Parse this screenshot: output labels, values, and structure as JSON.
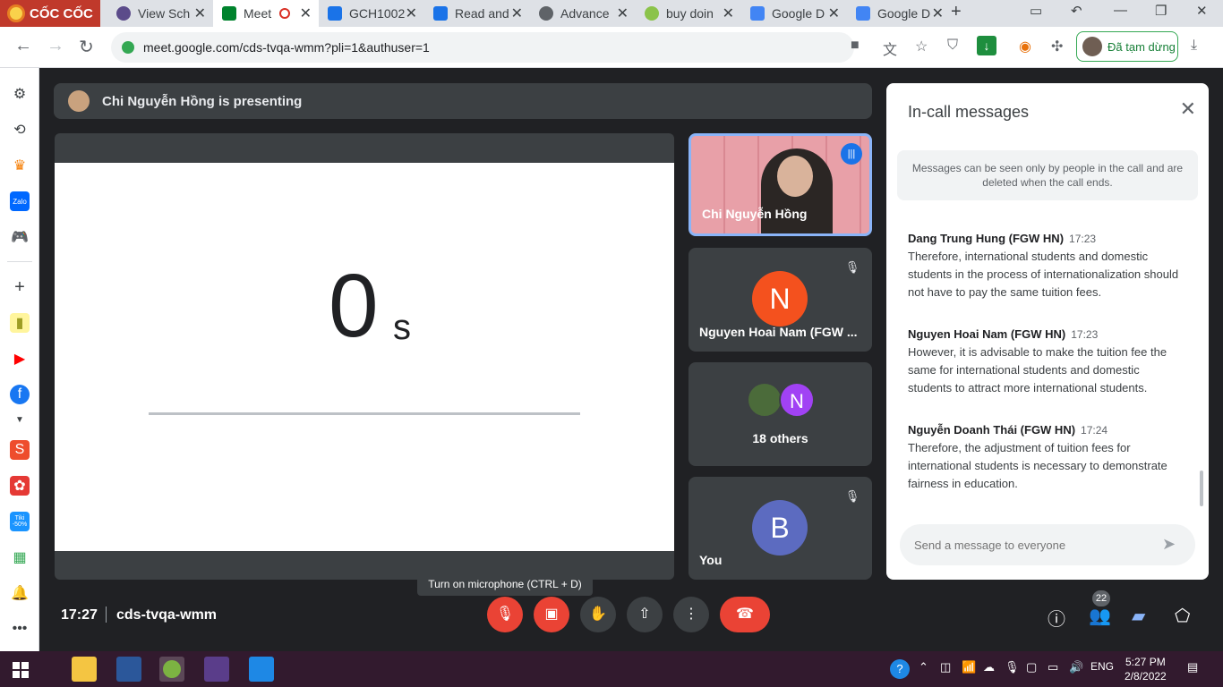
{
  "browser": {
    "brand": "CỐC CỐC",
    "tabs": [
      {
        "label": "View Sch",
        "color": "#5b4b8a"
      },
      {
        "label": "Meet",
        "color": "#00832d",
        "active": true
      },
      {
        "label": "GCH1002",
        "color": "#1a73e8"
      },
      {
        "label": "Read and",
        "color": "#1a73e8"
      },
      {
        "label": "Advance",
        "color": "#5f6368"
      },
      {
        "label": "buy doin",
        "color": "#8bc34a"
      },
      {
        "label": "Google D",
        "color": "#4285f4"
      },
      {
        "label": "Google D",
        "color": "#4285f4"
      }
    ],
    "url": "meet.google.com/cds-tvqa-wmm?pli=1&authuser=1",
    "profile_status": "Đã tạm dừng"
  },
  "sidebar": {
    "items": [
      "settings-icon",
      "history-icon",
      "crown-icon",
      "zalo-icon",
      "game-icon",
      "add-icon",
      "note-icon",
      "youtube-icon",
      "facebook-icon",
      "chevron-down-icon",
      "shopee-icon",
      "app-icon",
      "tiki-icon",
      "sheet-icon",
      "bell-icon",
      "more-icon"
    ],
    "zalo_label": "Zalo",
    "tiki_label": "Tiki -50%"
  },
  "meet": {
    "presenting_banner": "Chi Nguyễn Hồng is presenting",
    "slide": {
      "timer_value": "0",
      "timer_unit": "s"
    },
    "participants": [
      {
        "name": "Chi Nguyễn Hồng"
      },
      {
        "name": "Nguyen Hoai Nam (FGW ...",
        "initial": "N",
        "color": "#f4511e"
      },
      {
        "others": "18 others",
        "initial": "N"
      },
      {
        "name": "You",
        "initial": "B",
        "color": "#5c6bc0"
      }
    ],
    "chat": {
      "title": "In-call messages",
      "notice": "Messages can be seen only by people in the call and are deleted when the call ends.",
      "messages": [
        {
          "sender": "Dang Trung Hung (FGW HN)",
          "time": "17:23",
          "text": "Therefore, international students and domestic students in the process of internationalization should not have to pay the same tuition fees."
        },
        {
          "sender": "Nguyen Hoai Nam (FGW HN)",
          "time": "17:23",
          "text": "However, it is advisable to make the tuition fee the same for international students and domestic students to attract more international students."
        },
        {
          "sender": "Nguyễn Doanh Thái (FGW HN)",
          "time": "17:24",
          "text": "Therefore, the adjustment of tuition fees for international students is necessary to demonstrate fairness in education."
        }
      ],
      "input_placeholder": "Send a message to everyone"
    },
    "tooltip": "Turn on microphone (CTRL + D)",
    "clock": "17:27",
    "meeting_code": "cds-tvqa-wmm",
    "people_count": "22"
  },
  "taskbar": {
    "language": "ENG",
    "time": "5:27 PM",
    "date": "2/8/2022"
  }
}
